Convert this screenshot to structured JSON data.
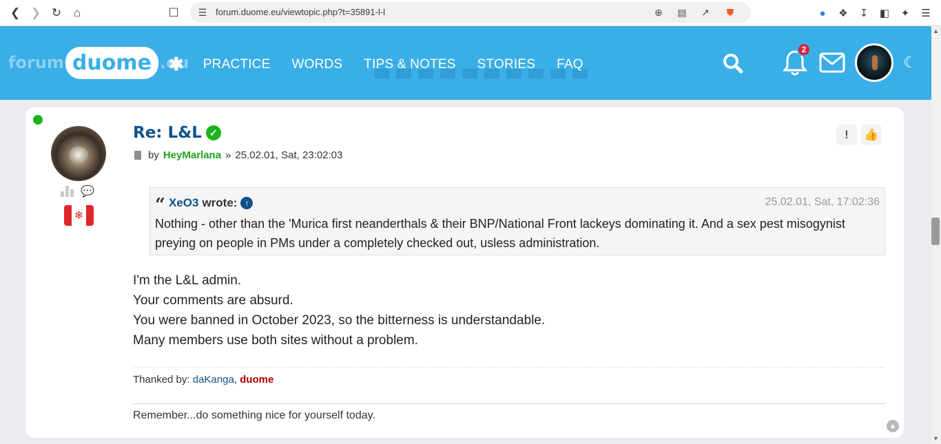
{
  "browser": {
    "url": "forum.duome.eu/viewtopic.php?t=35891-l-l",
    "icons": [
      "back-icon",
      "forward-icon",
      "reload-icon",
      "home-icon",
      "bookmark-icon",
      "site-info-icon",
      "zoom-icon",
      "reader-icon",
      "share-icon",
      "brave-shield-icon",
      "extension-s-icon",
      "puzzle-icon",
      "download-icon",
      "sidebar-icon",
      "leo-icon",
      "menu-icon"
    ]
  },
  "header": {
    "logo": {
      "part1": "forum",
      "part2": "duome",
      "part3": ".eu"
    },
    "menu": [
      "PRACTICE",
      "WORDS",
      "TIPS & NOTES",
      "STORIES",
      "FAQ"
    ],
    "notifications_count": "2",
    "colors": {
      "header_bg": "#3aaee6"
    }
  },
  "post": {
    "title": "Re: L&L",
    "by_label": "by",
    "author": "HeyMarlana",
    "separator": "»",
    "timestamp": "25.02.01, Sat, 23:02:03",
    "quote": {
      "author": "XeO3",
      "wrote_label": "wrote:",
      "date": "25.02.01, Sat, 17:02:36",
      "text": "Nothing - other than the 'Murica first neanderthals & their BNP/National Front lackeys dominating it. And a sex pest misogynist preying on people in PMs under a completely checked out, usless administration."
    },
    "body": [
      "I'm the L&L admin.",
      "Your comments are absurd.",
      "You were banned in October 2023, so the bitterness is understandable.",
      "Many members use both sites without a problem."
    ],
    "thanked_label": "Thanked by:",
    "thanked_by": [
      "daKanga",
      "duome"
    ],
    "signature": "Remember...do something nice for yourself today.",
    "colors": {
      "author": "#1aa31a",
      "link": "#105289",
      "admin": "#aa0000",
      "online": "#1bb31b"
    }
  }
}
